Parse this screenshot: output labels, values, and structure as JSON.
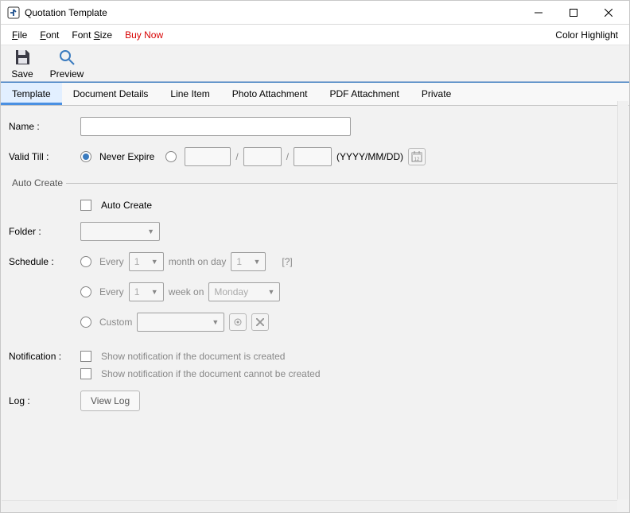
{
  "window": {
    "title": "Quotation Template"
  },
  "menu": {
    "file": "File",
    "font": "Font",
    "font_size": "Font Size",
    "buy_now": "Buy Now",
    "color_highlight": "Color Highlight"
  },
  "toolbar": {
    "save_label": "Save",
    "preview_label": "Preview"
  },
  "tabs": {
    "template": "Template",
    "document_details": "Document Details",
    "line_item": "Line Item",
    "photo_attachment": "Photo Attachment",
    "pdf_attachment": "PDF Attachment",
    "private": "Private"
  },
  "form": {
    "name_label": "Name :",
    "name_value": "",
    "valid_till_label": "Valid Till :",
    "never_expire": "Never Expire",
    "date_sep": "/",
    "date_format": "(YYYY/MM/DD)",
    "year": "",
    "month": "",
    "day": ""
  },
  "auto_create": {
    "legend": "Auto Create",
    "auto_create": "Auto Create",
    "folder_label": "Folder :",
    "folder_value": "",
    "schedule_label": "Schedule :",
    "every": "Every",
    "month_on_day": "month on day",
    "week_on": "week on",
    "monday": "Monday",
    "one": "1",
    "custom": "Custom",
    "help": "[?]",
    "notification_label": "Notification :",
    "notif_created": "Show notification if the document is created",
    "notif_failed": "Show notification if the document cannot be created",
    "log_label": "Log :",
    "view_log": "View Log"
  }
}
